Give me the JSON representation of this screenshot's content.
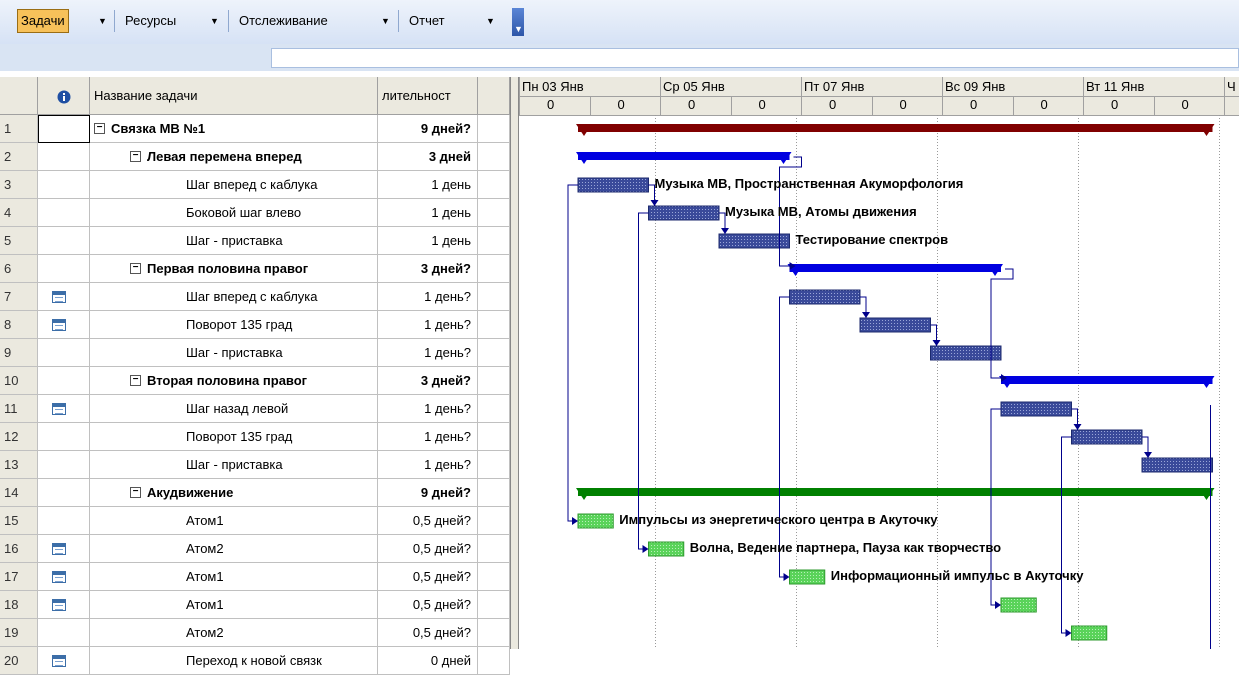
{
  "toolbar": {
    "buttons": [
      "Задачи",
      "Ресурсы",
      "Отслеживание",
      "Отчет"
    ],
    "dropdown_glyph": "▼"
  },
  "grid": {
    "columns": {
      "id": "",
      "indicators": "info-icon",
      "name": "Название задачи",
      "duration": "лительност"
    },
    "rows": [
      {
        "id": "1",
        "name": "Связка МВ №1",
        "duration": "9 дней?",
        "level": 0,
        "summary": true,
        "icon": ""
      },
      {
        "id": "2",
        "name": "Левая перемена вперед",
        "duration": "3 дней",
        "level": 1,
        "summary": true,
        "icon": ""
      },
      {
        "id": "3",
        "name": "Шаг вперед с каблука",
        "duration": "1 день",
        "level": 2,
        "summary": false,
        "icon": ""
      },
      {
        "id": "4",
        "name": "Боковой шаг влево",
        "duration": "1 день",
        "level": 2,
        "summary": false,
        "icon": ""
      },
      {
        "id": "5",
        "name": "Шаг - приставка",
        "duration": "1 день",
        "level": 2,
        "summary": false,
        "icon": ""
      },
      {
        "id": "6",
        "name": "Первая половина правог",
        "duration": "3 дней?",
        "level": 1,
        "summary": true,
        "icon": ""
      },
      {
        "id": "7",
        "name": "Шаг вперед с каблука",
        "duration": "1 день?",
        "level": 2,
        "summary": false,
        "icon": "calendar-icon"
      },
      {
        "id": "8",
        "name": "Поворот 135 град",
        "duration": "1 день?",
        "level": 2,
        "summary": false,
        "icon": "calendar-icon"
      },
      {
        "id": "9",
        "name": "Шаг - приставка",
        "duration": "1 день?",
        "level": 2,
        "summary": false,
        "icon": ""
      },
      {
        "id": "10",
        "name": "Вторая половина правог",
        "duration": "3 дней?",
        "level": 1,
        "summary": true,
        "icon": ""
      },
      {
        "id": "11",
        "name": "Шаг назад левой",
        "duration": "1 день?",
        "level": 2,
        "summary": false,
        "icon": "calendar-icon"
      },
      {
        "id": "12",
        "name": "Поворот 135 град",
        "duration": "1 день?",
        "level": 2,
        "summary": false,
        "icon": ""
      },
      {
        "id": "13",
        "name": "Шаг - приставка",
        "duration": "1 день?",
        "level": 2,
        "summary": false,
        "icon": ""
      },
      {
        "id": "14",
        "name": "Акудвижение",
        "duration": "9 дней?",
        "level": 1,
        "summary": true,
        "icon": ""
      },
      {
        "id": "15",
        "name": "Атом1",
        "duration": "0,5 дней?",
        "level": 2,
        "summary": false,
        "icon": ""
      },
      {
        "id": "16",
        "name": "Атом2",
        "duration": "0,5 дней?",
        "level": 2,
        "summary": false,
        "icon": "calendar-icon"
      },
      {
        "id": "17",
        "name": "Атом1",
        "duration": "0,5 дней?",
        "level": 2,
        "summary": false,
        "icon": "calendar-icon"
      },
      {
        "id": "18",
        "name": "Атом1",
        "duration": "0,5 дней?",
        "level": 2,
        "summary": false,
        "icon": "calendar-icon"
      },
      {
        "id": "19",
        "name": "Атом2",
        "duration": "0,5 дней?",
        "level": 2,
        "summary": false,
        "icon": ""
      },
      {
        "id": "20",
        "name": "Переход к новой связк",
        "duration": "0 дней",
        "level": 2,
        "summary": false,
        "icon": "calendar-icon"
      }
    ]
  },
  "timescale": {
    "major": [
      "Пн 03 Янв",
      "Ср 05 Янв",
      "Пт 07 Янв",
      "Вс 09 Янв",
      "Вт 11 Янв",
      "Ч"
    ],
    "minor_label": "0"
  },
  "gantt": {
    "colors": {
      "top_summary": "#800000",
      "summary": "#0000e0",
      "akud_summary": "#008000",
      "task": "#3a4a9a",
      "atom": "#5ad35a",
      "link": "#00008b"
    },
    "bars": [
      {
        "row": 0,
        "kind": "summary",
        "color_key": "top_summary",
        "start_day": 0.0,
        "end_day": 9.0
      },
      {
        "row": 1,
        "kind": "summary",
        "color_key": "summary",
        "start_day": 0.0,
        "end_day": 3.0
      },
      {
        "row": 2,
        "kind": "task",
        "start_day": 0.0,
        "end_day": 1.0,
        "label": "Музыка МВ, Пространственная Акуморфология"
      },
      {
        "row": 3,
        "kind": "task",
        "start_day": 1.0,
        "end_day": 2.0,
        "label": "Музыка МВ, Атомы движения"
      },
      {
        "row": 4,
        "kind": "task",
        "start_day": 2.0,
        "end_day": 3.0,
        "label": "Тестирование спектров"
      },
      {
        "row": 5,
        "kind": "summary",
        "color_key": "summary",
        "start_day": 3.0,
        "end_day": 6.0
      },
      {
        "row": 6,
        "kind": "task",
        "start_day": 3.0,
        "end_day": 4.0,
        "label": ""
      },
      {
        "row": 7,
        "kind": "task",
        "start_day": 4.0,
        "end_day": 5.0,
        "label": ""
      },
      {
        "row": 8,
        "kind": "task",
        "start_day": 5.0,
        "end_day": 6.0,
        "label": ""
      },
      {
        "row": 9,
        "kind": "summary",
        "color_key": "summary",
        "start_day": 6.0,
        "end_day": 9.0
      },
      {
        "row": 10,
        "kind": "task",
        "start_day": 6.0,
        "end_day": 7.0,
        "label": ""
      },
      {
        "row": 11,
        "kind": "task",
        "start_day": 7.0,
        "end_day": 8.0,
        "label": ""
      },
      {
        "row": 12,
        "kind": "task",
        "start_day": 8.0,
        "end_day": 9.0,
        "label": ""
      },
      {
        "row": 13,
        "kind": "summary",
        "color_key": "akud_summary",
        "start_day": 0.0,
        "end_day": 9.0
      },
      {
        "row": 14,
        "kind": "atom",
        "start_day": 0.0,
        "end_day": 0.5,
        "label": "Импульсы из энергетического центра в Акуточку"
      },
      {
        "row": 15,
        "kind": "atom",
        "start_day": 1.0,
        "end_day": 1.5,
        "label": "Волна, Ведение партнера, Пауза как творчество"
      },
      {
        "row": 16,
        "kind": "atom",
        "start_day": 3.0,
        "end_day": 3.5,
        "label": "Информационный импульс в Акуточку"
      },
      {
        "row": 17,
        "kind": "atom",
        "start_day": 6.0,
        "end_day": 6.5,
        "label": ""
      },
      {
        "row": 18,
        "kind": "atom",
        "start_day": 7.0,
        "end_day": 7.5,
        "label": ""
      },
      {
        "row": 19,
        "kind": "milestone",
        "start_day": 9.0,
        "end_day": 9.0,
        "label": ""
      }
    ]
  }
}
